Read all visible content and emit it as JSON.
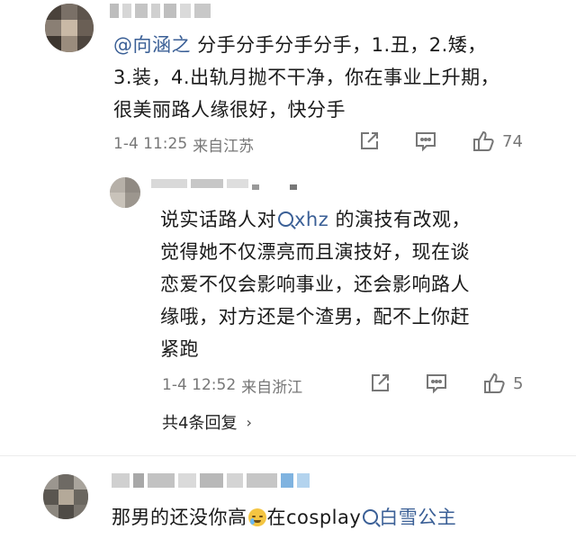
{
  "comment1": {
    "mention": "@向涵之",
    "lines": [
      " 分手分手分手分手，1.丑，2.矮，",
      "3.装，4.出轨月抛不干净，你在事业上升期，",
      "很美丽路人缘很好，快分手"
    ],
    "time": "1-4 11:25",
    "location": "来自江苏",
    "like_count": "74"
  },
  "reply": {
    "line1_before": "说实话路人对",
    "line1_topic": "xhz",
    "line1_after": "的演技有改观，",
    "lines": [
      "觉得她不仅漂亮而且演技好，现在谈",
      "恋爱不仅会影响事业，还会影响路人",
      "缘哦，对方还是个渣男，配不上你赶",
      "紧跑"
    ],
    "time": "1-4 12:52",
    "location": "来自浙江",
    "like_count": "5"
  },
  "replies_link": {
    "label": "共4条回复",
    "chevron": "›"
  },
  "comment2": {
    "text_before": "那男的还没你高",
    "text_middle": "在cosplay",
    "topic": "白雪公主"
  },
  "icons": {
    "share": "share-icon",
    "comment": "comment-icon",
    "like": "thumbs-up-icon",
    "search": "search-icon",
    "emoji": "crying-laugh-emoji"
  },
  "colors": {
    "link": "#3a5f96",
    "meta": "#777777",
    "text": "#1a1a1a"
  }
}
